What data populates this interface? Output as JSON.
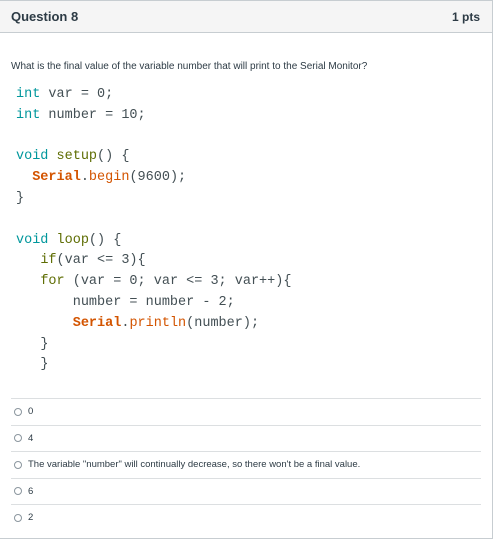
{
  "header": {
    "title": "Question 8",
    "points": "1 pts"
  },
  "prompt": "What is the final value of the variable number that will print to the Serial Monitor?",
  "code": {
    "line1": {
      "kw": "int",
      "rest": " var = 0;"
    },
    "line2": {
      "kw": "int",
      "rest": " number = 10;"
    },
    "setup_kw": "void",
    "setup_fn": "setup",
    "setup_rest": "() {",
    "serial": "Serial",
    "begin_method": "begin",
    "begin_rest": "(9600);",
    "close1": "}",
    "loop_kw": "void",
    "loop_fn": "loop",
    "loop_rest": "() {",
    "if_kw": "if",
    "if_rest": "(var <= 3){",
    "for_kw": "for",
    "for_rest": " (var = 0; var <= 3; var++){",
    "assign": "number = number - 2;",
    "println_method": "println",
    "println_rest": "(number);",
    "close_for": "}",
    "close_if": "}"
  },
  "answers": [
    {
      "label": "0"
    },
    {
      "label": "4"
    },
    {
      "label": "The variable \"number\" will continually decrease, so there won't be a final value."
    },
    {
      "label": "6"
    },
    {
      "label": "2"
    }
  ]
}
